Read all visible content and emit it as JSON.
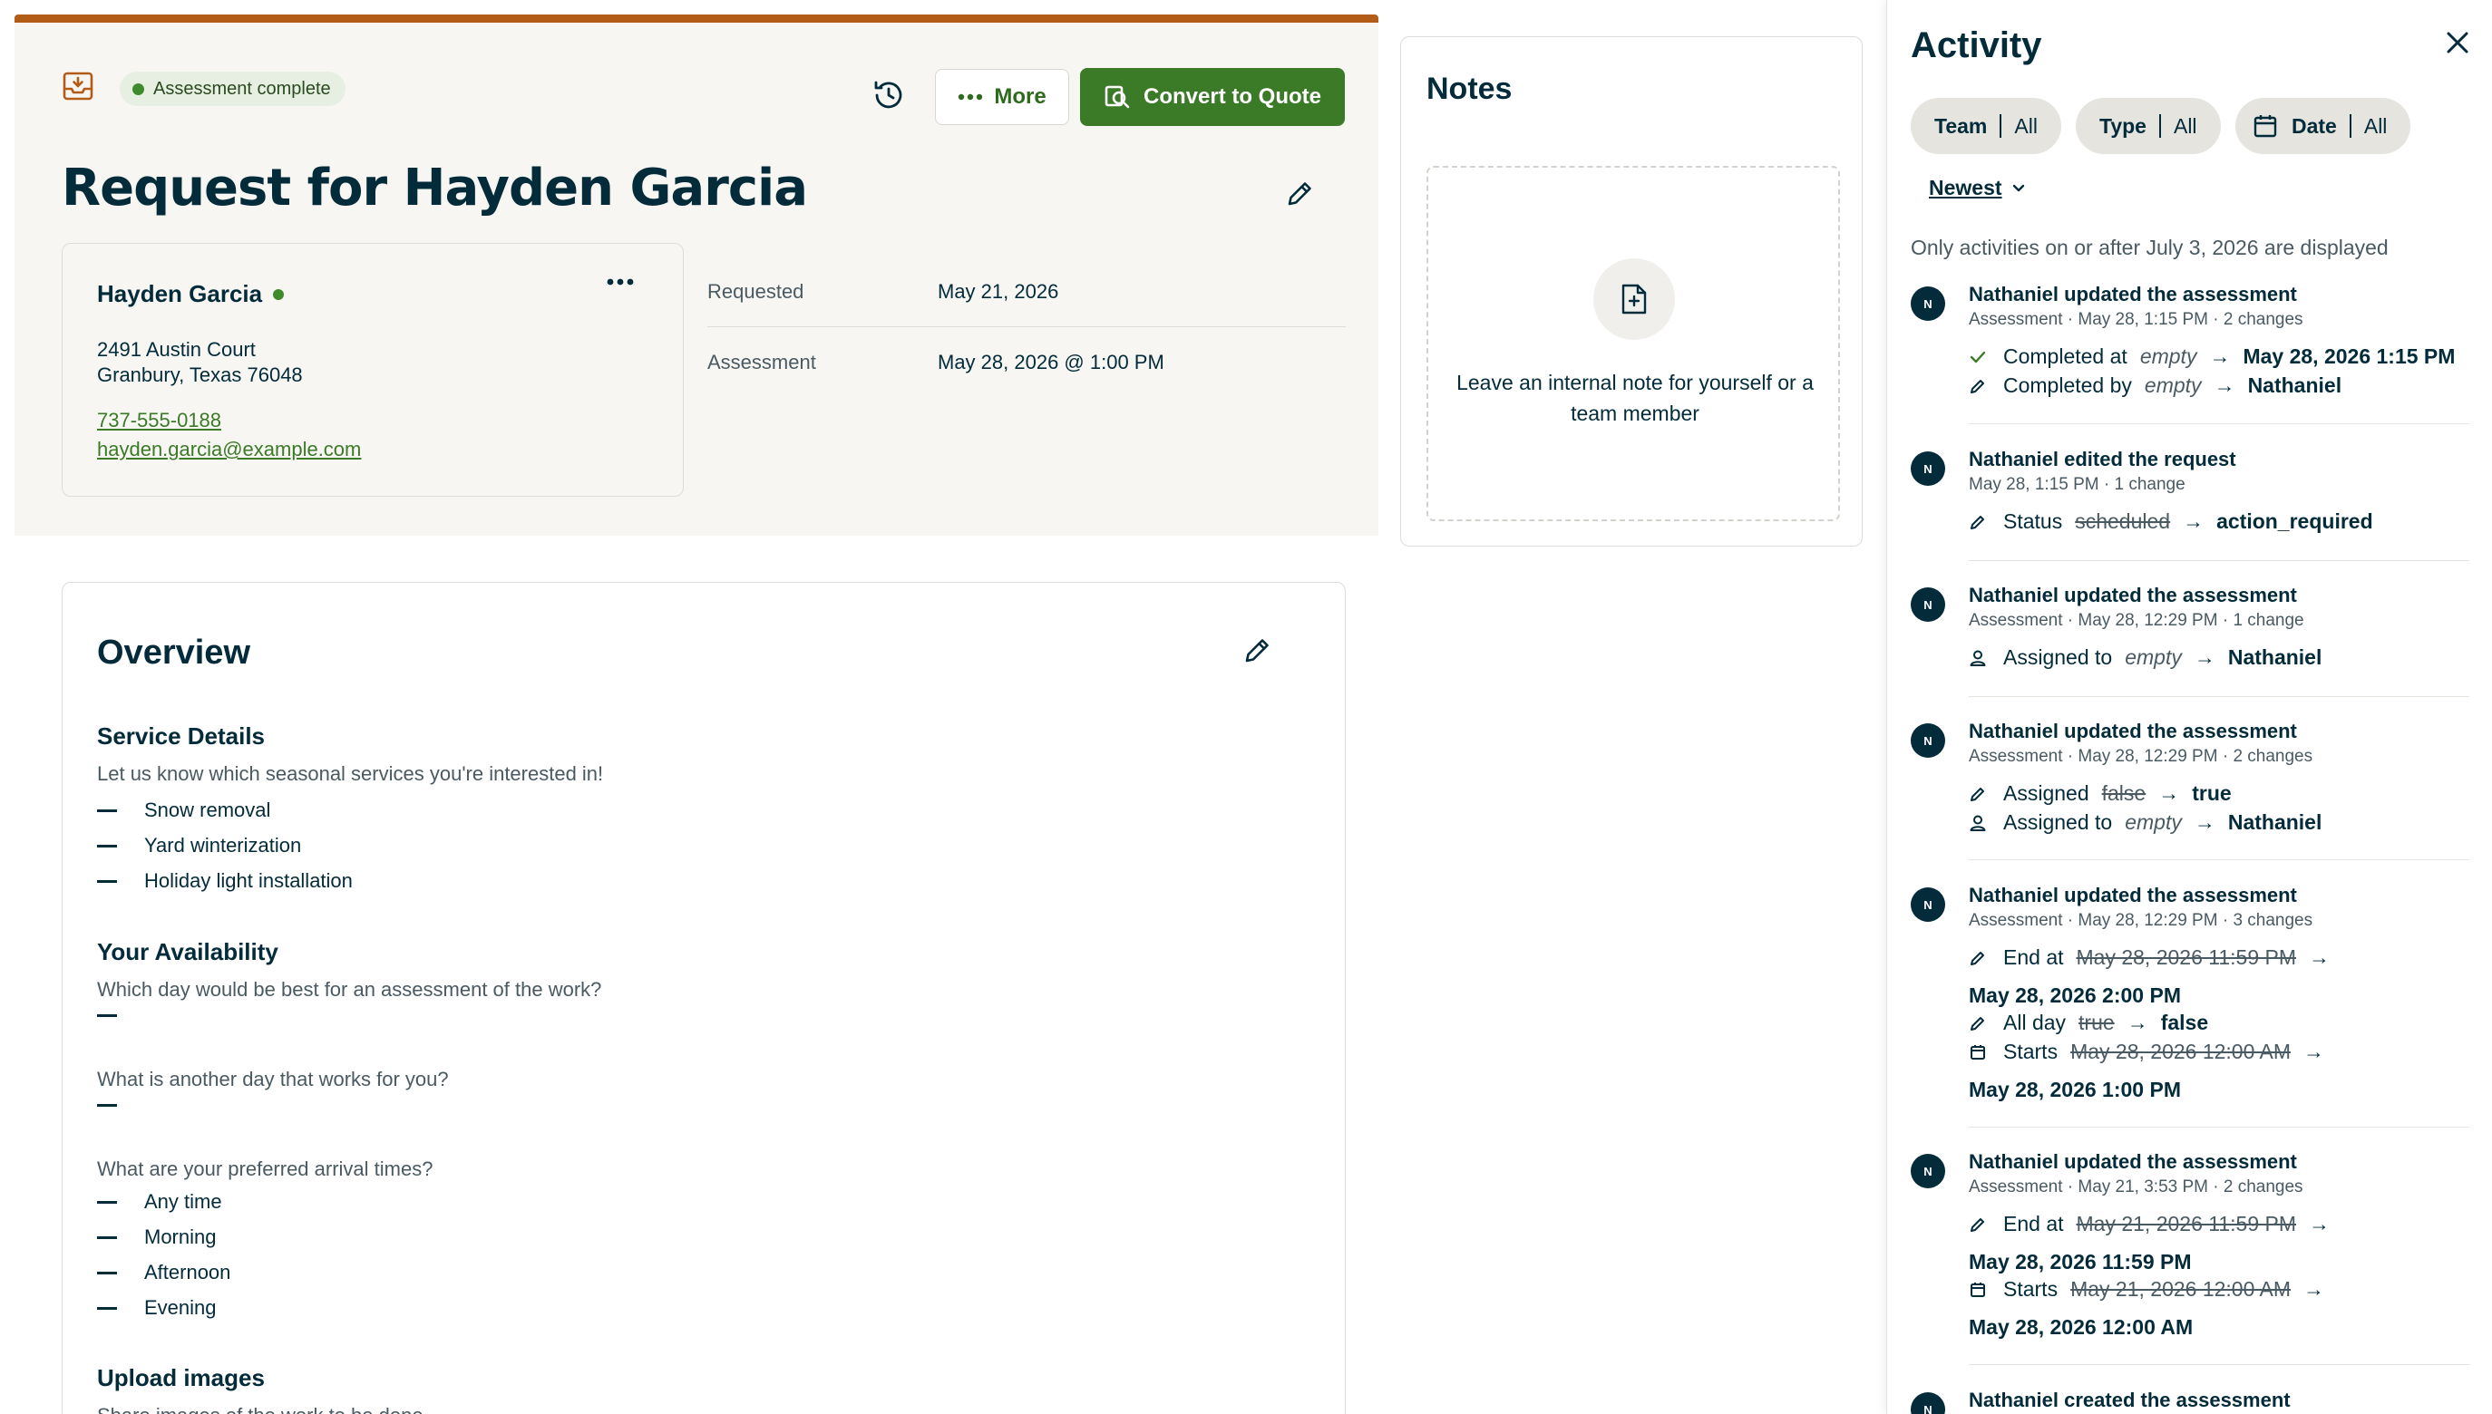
{
  "request": {
    "status_badge": "Assessment complete",
    "more_label": "More",
    "convert_label": "Convert to Quote",
    "title": "Request for Hayden Garcia",
    "client": {
      "name": "Hayden Garcia",
      "address_line1": "2491 Austin Court",
      "address_line2": "Granbury, Texas 76048",
      "phone": "737-555-0188",
      "email": "hayden.garcia@example.com"
    },
    "meta": [
      {
        "label": "Requested",
        "value": "May 21, 2026"
      },
      {
        "label": "Assessment",
        "value": "May 28, 2026 @ 1:00 PM"
      }
    ],
    "overview": {
      "title": "Overview",
      "service_heading": "Service Details",
      "service_question": "Let us know which seasonal services you're interested in!",
      "services": [
        "Snow removal",
        "Yard winterization",
        "Holiday light installation"
      ],
      "availability_heading": "Your Availability",
      "q_best_day": "Which day would be best for an assessment of the work?",
      "q_another_day": "What is another day that works for you?",
      "q_arrival": "What are your preferred arrival times?",
      "arrival_times": [
        "Any time",
        "Morning",
        "Afternoon",
        "Evening"
      ],
      "upload_heading": "Upload images",
      "upload_question": "Share images of the work to be done"
    }
  },
  "notes": {
    "title": "Notes",
    "empty_text": "Leave an internal note for yourself or a team member"
  },
  "activity": {
    "title": "Activity",
    "filters": [
      {
        "label": "Team",
        "value": "All"
      },
      {
        "label": "Type",
        "value": "All"
      },
      {
        "label": "Date",
        "value": "All"
      }
    ],
    "sort": "Newest",
    "notice": "Only activities on or after July 3, 2026 are displayed",
    "avatar_initial": "N",
    "arrow": "→",
    "entries": [
      {
        "who": "Nathaniel updated the assessment",
        "sub": "Assessment · May 28, 1:15 PM · 2 changes",
        "changes": [
          {
            "field": "Completed at",
            "old": "empty",
            "new": "May 28, 2026 1:15 PM"
          },
          {
            "field": "Completed by",
            "old": "empty",
            "new": "Nathaniel"
          }
        ]
      },
      {
        "who": "Nathaniel edited the request",
        "sub": "May 28, 1:15 PM · 1 change",
        "changes": [
          {
            "field": "Status",
            "old": "scheduled",
            "new": "action_required"
          }
        ]
      },
      {
        "who": "Nathaniel updated the assessment",
        "sub": "Assessment · May 28, 12:29 PM · 1 change",
        "changes": [
          {
            "field": "Assigned to",
            "old": "empty",
            "new": "Nathaniel"
          }
        ]
      },
      {
        "who": "Nathaniel updated the assessment",
        "sub": "Assessment · May 28, 12:29 PM · 2 changes",
        "changes": [
          {
            "field": "Assigned",
            "old": "false",
            "new": "true"
          },
          {
            "field": "Assigned to",
            "old": "empty",
            "new": "Nathaniel"
          }
        ]
      },
      {
        "who": "Nathaniel updated the assessment",
        "sub": "Assessment · May 28, 12:29 PM · 3 changes",
        "changes": [
          {
            "field": "End at",
            "old": "May 28, 2026 11:59 PM",
            "new": "May 28, 2026 2:00 PM"
          },
          {
            "field": "All day",
            "old": "true",
            "new": "false"
          },
          {
            "field": "Starts",
            "old": "May 28, 2026 12:00 AM",
            "new": "May 28, 2026 1:00 PM"
          }
        ]
      },
      {
        "who": "Nathaniel updated the assessment",
        "sub": "Assessment · May 21, 3:53 PM · 2 changes",
        "changes": [
          {
            "field": "End at",
            "old": "May 21, 2026 11:59 PM",
            "new": "May 28, 2026 11:59 PM"
          },
          {
            "field": "Starts",
            "old": "May 21, 2026 12:00 AM",
            "new": "May 28, 2026 12:00 AM"
          }
        ]
      },
      {
        "who": "Nathaniel created the assessment",
        "sub": "",
        "changes": []
      }
    ]
  },
  "colors": {
    "accent_green": "#3b7a27",
    "top_bar": "#b35c17",
    "navy": "#032b3a",
    "header_bg": "#f7f6f3"
  }
}
